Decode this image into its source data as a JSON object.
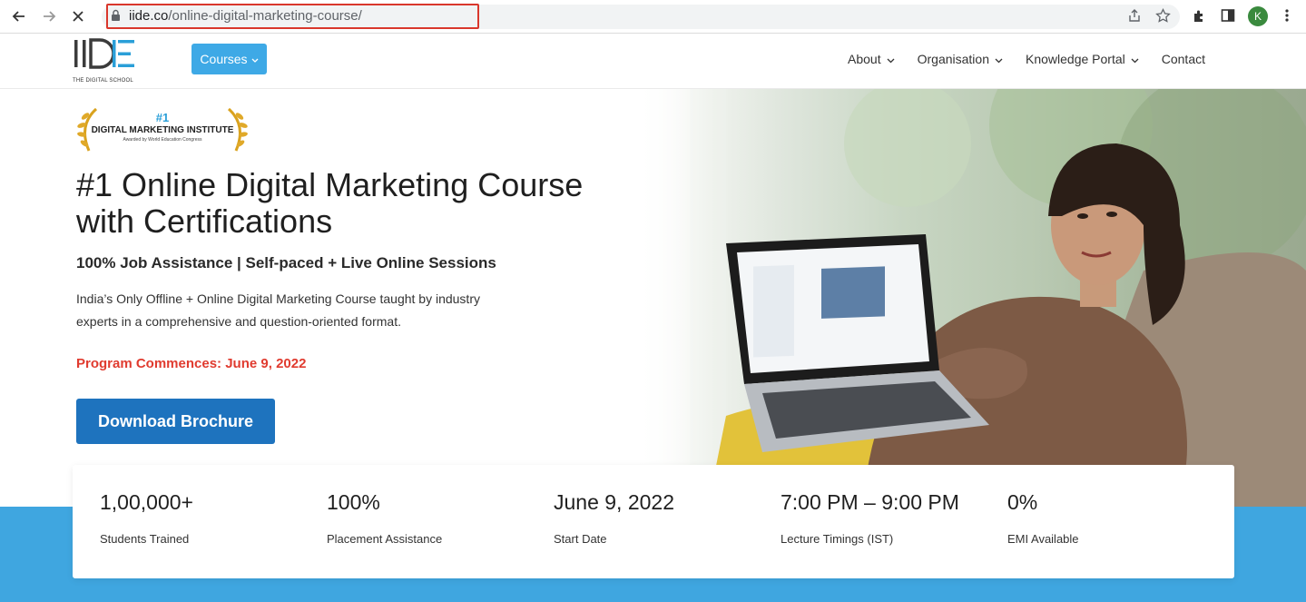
{
  "browser": {
    "url_host": "iide.co",
    "url_path": "/online-digital-marketing-course/",
    "profile_initial": "K"
  },
  "header": {
    "logo_text": "IIDE",
    "logo_sub": "THE DIGITAL SCHOOL",
    "courses_label": "Courses",
    "nav": [
      {
        "label": "About",
        "dropdown": true
      },
      {
        "label": "Organisation",
        "dropdown": true
      },
      {
        "label": "Knowledge Portal",
        "dropdown": true
      },
      {
        "label": "Contact",
        "dropdown": false
      }
    ]
  },
  "badge": {
    "rank": "#1",
    "title": "DIGITAL MARKETING INSTITUTE",
    "subtitle": "Awarded by World Education Congress"
  },
  "hero": {
    "title": "#1 Online Digital Marketing Course with Certifications",
    "subtitle": "100% Job Assistance | Self-paced + Live Online Sessions",
    "description": "India’s Only Offline + Online Digital Marketing Course taught by industry experts in a comprehensive and question-oriented format.",
    "commence": "Program Commences: June 9, 2022",
    "cta_label": "Download Brochure"
  },
  "stats": [
    {
      "value": "1,00,000+",
      "label": "Students Trained"
    },
    {
      "value": "100%",
      "label": "Placement Assistance"
    },
    {
      "value": "June 9, 2022",
      "label": "Start Date"
    },
    {
      "value": "7:00 PM – 9:00 PM",
      "label": "Lecture Timings (IST)"
    },
    {
      "value": "0%",
      "label": "EMI Available"
    }
  ],
  "colors": {
    "accent": "#3ea9e6",
    "cta": "#1e73be",
    "highlight_red": "#e03b2f",
    "band": "#3fa6e0"
  }
}
